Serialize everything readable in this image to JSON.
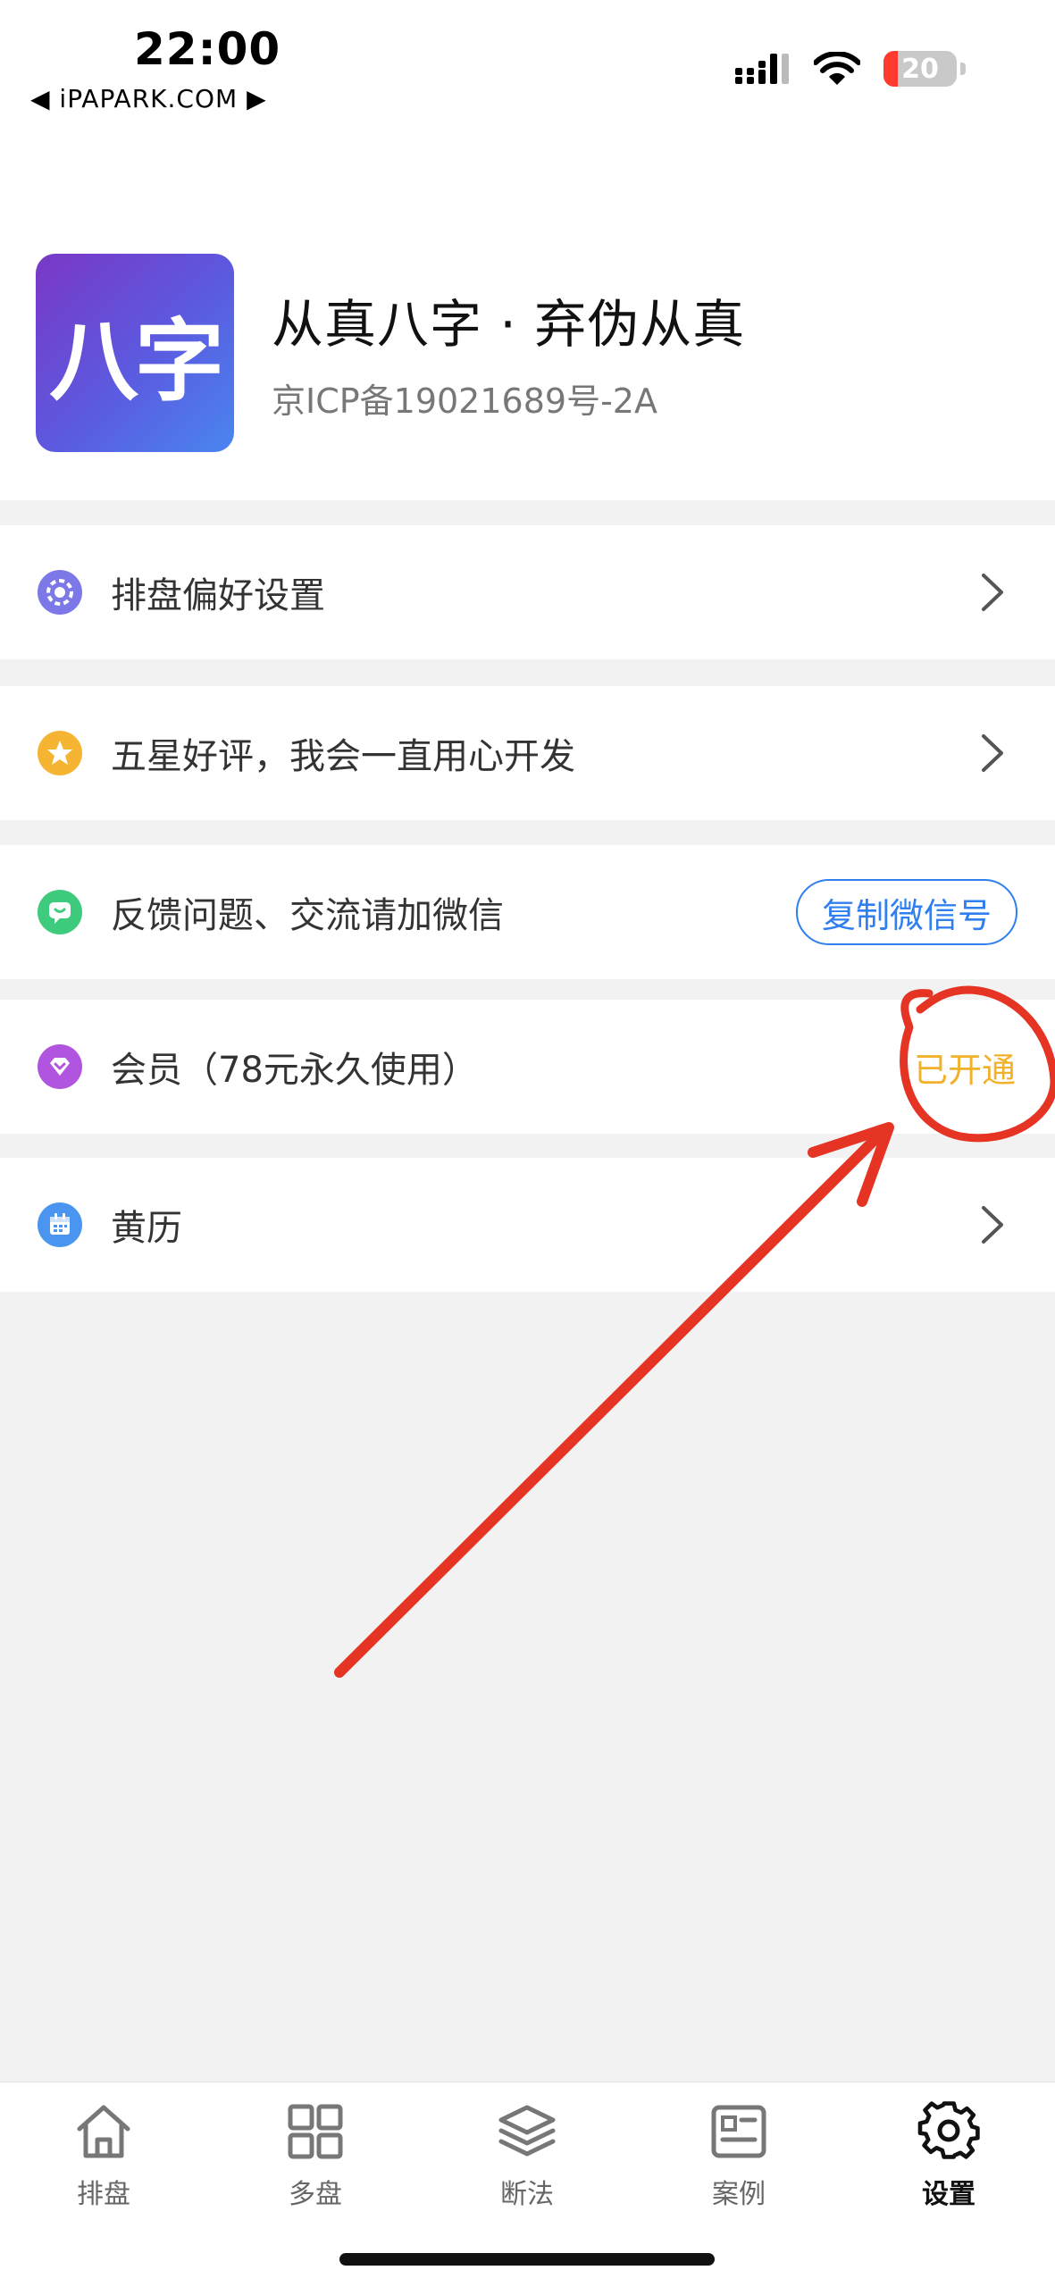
{
  "status_bar": {
    "time": "22:00",
    "back_label": "◀ iPAPARK.COM ▶",
    "battery_level": "20",
    "icons": [
      "signal-icon",
      "wifi-icon",
      "battery-icon"
    ]
  },
  "app": {
    "logo_text": "八字",
    "name": "从真八字 · 弃伪从真",
    "icp": "京ICP备19021689号-2A"
  },
  "menu": {
    "preferences_label": "排盘偏好设置",
    "rating_label": "五星好评，我会一直用心开发",
    "feedback_label": "反馈问题、交流请加微信",
    "copy_wechat_label": "复制微信号",
    "membership_label": "会员（78元永久使用）",
    "membership_status": "已开通",
    "almanac_label": "黄历"
  },
  "tabs": {
    "paipan": "排盘",
    "duopan": "多盘",
    "duanfa": "断法",
    "anli": "案例",
    "shezhi": "设置"
  },
  "colors": {
    "accent_blue": "#2f7ff0",
    "member_gold": "#f2b12b",
    "annotation_red": "#e53324"
  }
}
